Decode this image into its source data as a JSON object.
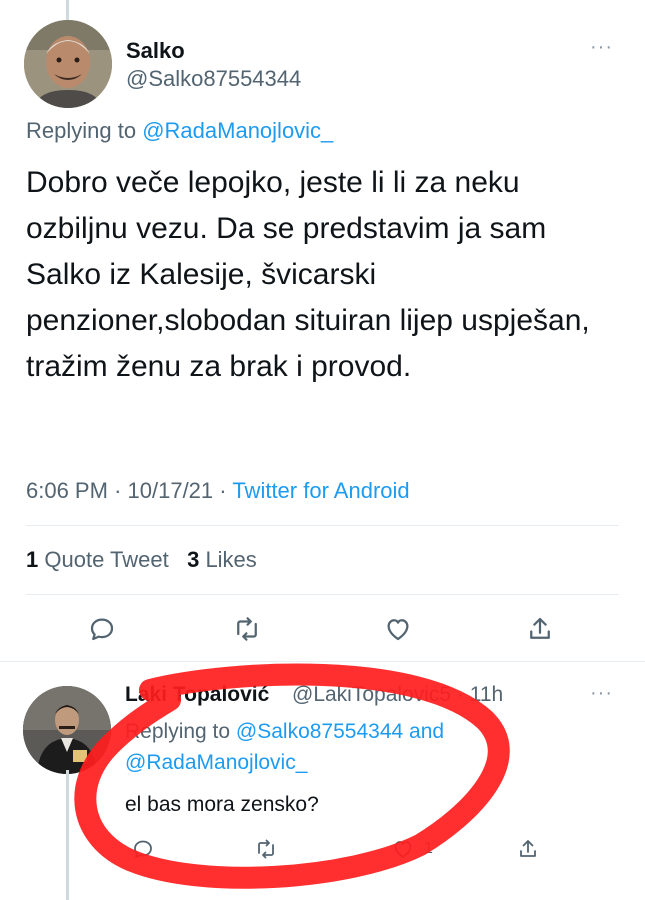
{
  "tweet": {
    "author_name": "Salko",
    "author_handle": "@Salko87554344",
    "replying_prefix": "Replying to",
    "replying_to": "@RadaManojlovic_",
    "text": "Dobro veče lepojko, jeste li li za neku ozbiljnu vezu. Da se predstavim ja sam Salko iz Kalesije, švicarski penzioner,slobodan situiran lijep uspješan, tražim ženu za brak i provod.",
    "time": "6:06 PM",
    "date": "10/17/21",
    "source": "Twitter for Android",
    "quote_count": "1",
    "quote_label": "Quote Tweet",
    "like_count": "3",
    "like_label": "Likes",
    "more": "···"
  },
  "reply": {
    "author_name": "Laki Topalović",
    "author_handle": "@LakiTopalovic5",
    "time": "11h",
    "replying_prefix": "Replying to",
    "replying_to_1": "@Salko87554344",
    "and_word": "and",
    "replying_to_2": "@RadaManojlovic_",
    "text": "el bas mora zensko?",
    "like_count": "1",
    "more": "···"
  },
  "icons": [
    "reply-icon",
    "retweet-icon",
    "like-icon",
    "share-icon"
  ],
  "colors": {
    "accent": "#1d9bf0",
    "secondary_text": "#536471",
    "annotation": "#ff1d1d"
  }
}
